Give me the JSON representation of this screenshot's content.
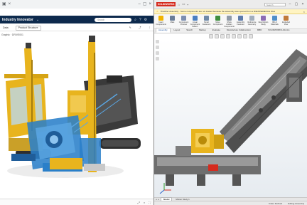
{
  "browser": {
    "tab_icons": [
      "tab-page-icon",
      "close-icon"
    ],
    "window_icons": [
      "minimize-icon",
      "maximize-icon",
      "close-icon"
    ]
  },
  "app": {
    "title": "Industry Innovator",
    "title_chevron": "⌄",
    "search_placeholder": "Search",
    "header_icons": [
      "help-icon",
      "settings-icon"
    ]
  },
  "subtoolbar": {
    "left_label": "Data",
    "mode_label": "Product Structure",
    "right_icons": [
      "edit-icon",
      "share-icon",
      "more-icon"
    ]
  },
  "left_pane": {
    "label": "Graphic · DRIVE001"
  },
  "left_status_icons": [
    "expand-icon",
    "close-icon",
    "fullscreen-icon"
  ],
  "sw": {
    "logo": "SOLIDWORKS",
    "search_placeholder": "Search",
    "banner_text": "Thatcher Assembly · Some components are not loaded because the assembly was opened from a 3DEXPERIENCE Files",
    "commands": [
      {
        "label": "Insert Components",
        "color": "#f1b400"
      },
      {
        "label": "Mate",
        "color": "#6a7d97"
      },
      {
        "label": "Component Preview",
        "color": "#7d8fb0"
      },
      {
        "label": "Linear Component Pattern",
        "color": "#4a7fc1"
      },
      {
        "label": "Smart Fasteners",
        "color": "#6f8aa8"
      },
      {
        "label": "Move Component",
        "color": "#3f8e3f"
      },
      {
        "label": "Show Hidden Components",
        "color": "#8f9aa6"
      },
      {
        "label": "Assembly Features",
        "color": "#5d7baa"
      },
      {
        "label": "Reference Geometry",
        "color": "#a2aebc"
      },
      {
        "label": "New Motion Study",
        "color": "#8c6bb3"
      },
      {
        "label": "Bill of Materials",
        "color": "#4f8ec9"
      },
      {
        "label": "Exploded View",
        "color": "#c07a3a"
      }
    ],
    "tabs": [
      "Assembly",
      "Layout",
      "Sketch",
      "Markup",
      "Evaluate",
      "Manufacture Collaboration",
      "MBD",
      "SOLIDWORKS Add-Ins"
    ],
    "active_tab": "Assembly",
    "bottom_tabs": [
      "Model",
      "Motion Study 1"
    ],
    "active_bottom_tab": "Model",
    "status_items": [
      "Under Defined",
      "Editing Assembly"
    ]
  },
  "colors": {
    "app_header": "#0d2a4d",
    "machine_yellow": "#e8b41e",
    "machine_blue": "#2a7fc9",
    "track_dark": "#2e2e2e",
    "sw_red": "#d52b1e",
    "banner_yellow": "#fff4c2"
  }
}
